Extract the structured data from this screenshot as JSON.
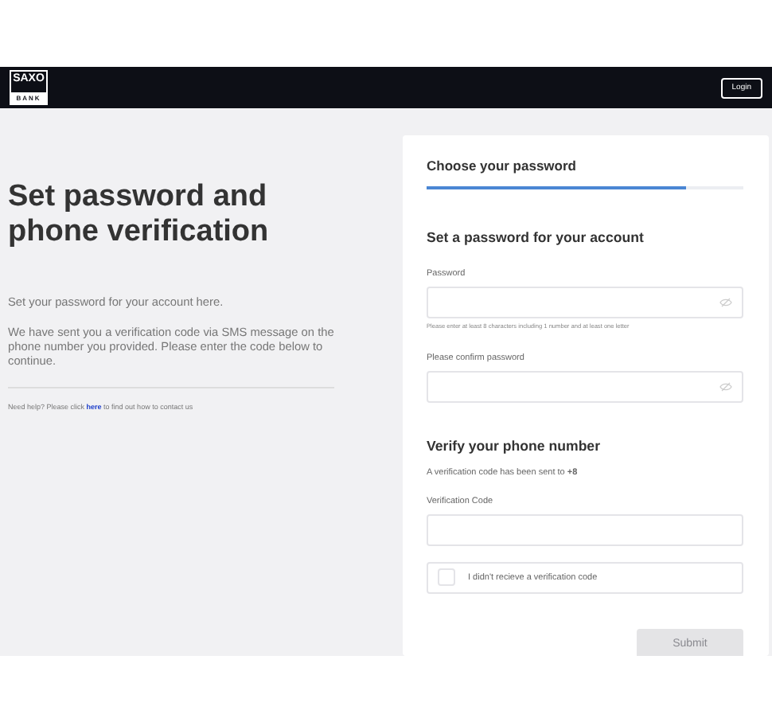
{
  "header": {
    "logo_top": "SAXO",
    "logo_bottom": "BANK",
    "login_button": "Login"
  },
  "intro": {
    "title": "Set password and phone verification",
    "paragraphs": [
      "Set your password for your account here.",
      "We have sent you a verification code via SMS message on the phone number you provided. Please enter the code below to continue."
    ],
    "help": {
      "before": "Need help? Please click",
      "link": "here",
      "after": "to find out how to contact us"
    }
  },
  "form": {
    "step_title": "Choose your password",
    "progress": {
      "level": 0.82
    },
    "password_section": {
      "title": "Set a password for your account",
      "fields": [
        {
          "label": "Password",
          "hint": "Please enter at least 8 characters including 1 number and at least one letter"
        },
        {
          "label": "Please confirm password"
        }
      ]
    },
    "phone_section": {
      "title": "Verify your phone number",
      "note": "A verification code has been sent to **+8**",
      "code_label": "Verification Code",
      "no_code": {
        "label": "I didn't recieve a verification code",
        "checked": false
      }
    },
    "submit": {
      "label": "Submit",
      "disabled": true
    }
  }
}
